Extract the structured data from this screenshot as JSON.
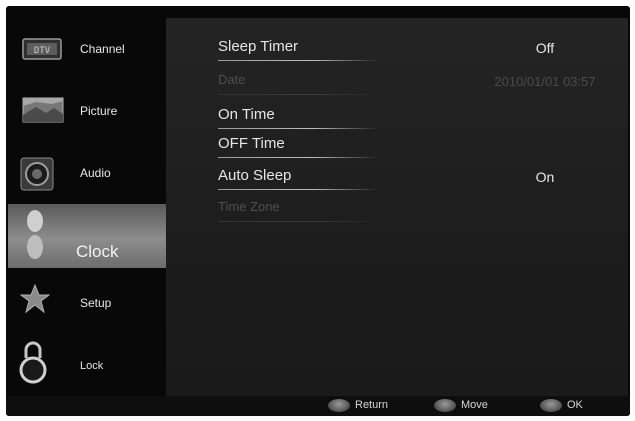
{
  "sidebar": {
    "items": [
      {
        "label": "Channel",
        "icon": "channel-icon",
        "active": false
      },
      {
        "label": "Picture",
        "icon": "picture-icon",
        "active": false
      },
      {
        "label": "Audio",
        "icon": "audio-icon",
        "active": false
      },
      {
        "label": "Clock",
        "icon": "clock-icon",
        "active": true
      },
      {
        "label": "Setup",
        "icon": "setup-icon",
        "active": false
      },
      {
        "label": "Lock",
        "icon": "lock-icon",
        "active": false
      }
    ]
  },
  "clock_menu": {
    "rows": [
      {
        "label": "Sleep Timer",
        "value": "Off",
        "enabled": true
      },
      {
        "label": "Date",
        "value": "2010/01/01 03:57",
        "enabled": false
      },
      {
        "label": "On Time",
        "value": "",
        "enabled": true
      },
      {
        "label": "OFF Time",
        "value": "",
        "enabled": true
      },
      {
        "label": "Auto Sleep",
        "value": "On",
        "enabled": true
      },
      {
        "label": "Time Zone",
        "value": "",
        "enabled": false
      }
    ]
  },
  "footer": {
    "return_label": "Return",
    "move_label": "Move",
    "ok_label": "OK"
  },
  "colors": {
    "background": "#080808",
    "panel": "#222222",
    "active_item": "#8d8d8d",
    "text": "#e6e6e6",
    "disabled_text": "#4e4e4e"
  }
}
